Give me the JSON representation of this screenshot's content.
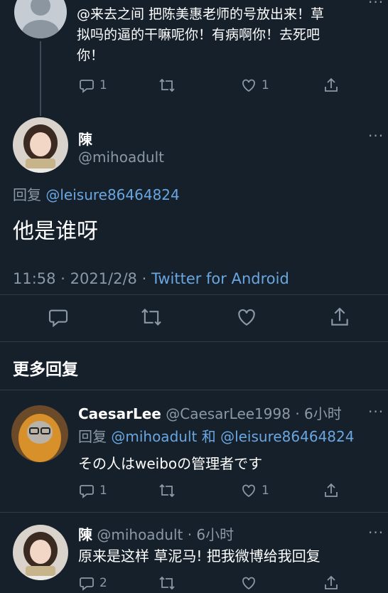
{
  "tweet1": {
    "text_line1": "@来去之间  把陈美惠老师的号放出来！草",
    "text_line2": "拟吗的逼的干嘛呢你！有病啊你！去死吧",
    "text_line3": "你！",
    "reply_count": "1",
    "like_count": "1"
  },
  "main_tweet": {
    "name": "陳",
    "handle": "@mihoadult",
    "reply_prefix": "回复",
    "reply_to": "@leisure86464824",
    "text": "他是谁呀",
    "time": "11:58",
    "sep1": "·",
    "date": "2021/2/8",
    "sep2": "·",
    "source": "Twitter for Android"
  },
  "more_replies": {
    "heading": "更多回复"
  },
  "reply1": {
    "name": "CaesarLee",
    "handle_time": "@CaesarLee1998 · 6小时",
    "reply_prefix": "回复",
    "reply_to_a": "@mihoadult",
    "conj": "和",
    "reply_to_b": "@leisure86464824",
    "text": "その人はweiboの管理者です",
    "reply_count": "1",
    "like_count": "1"
  },
  "reply2": {
    "name": "陳",
    "handle_time": "@mihoadult · 6小时",
    "text": "原来是这样 草泥马! 把我微博给我回复",
    "reply_count": "2"
  },
  "colors": {
    "background": "#15202b",
    "muted": "#8b98a5",
    "link": "#6aa6e0"
  }
}
